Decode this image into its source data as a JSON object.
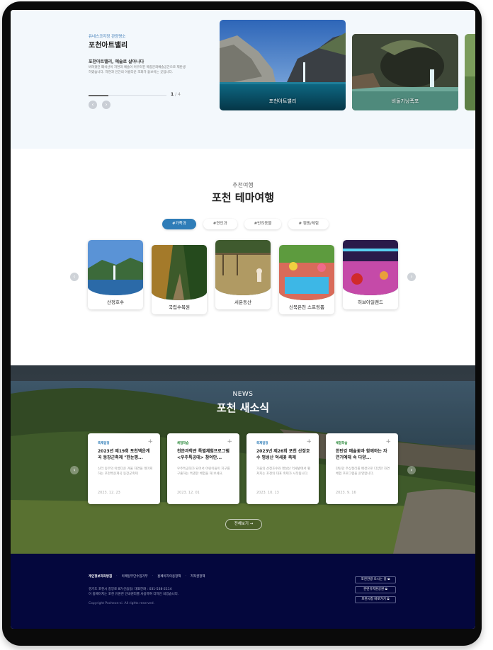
{
  "hero": {
    "category": "유네스코지정 관광명소",
    "title": "포천아트밸리",
    "subtitle": "포천아트밸리, 예술로 살아나다",
    "description": "버려졌던 폐석산이 자연과 예술이 어우러진 복합문화예술공간으로 재탄생하였습니다. 자연과 인간의 아름다운 조화가 돋보이는 곳입니다.",
    "counter_current": "1",
    "counter_separator": "/",
    "counter_total": "4",
    "progress": 0.25,
    "prev_icon": "‹",
    "next_icon": "›",
    "slides": [
      {
        "caption": "포천아트밸리",
        "icon": "photo"
      },
      {
        "caption": "비둘기낭폭포",
        "icon": "photo"
      }
    ]
  },
  "theme": {
    "kicker": "추천여행",
    "title": "포천 테마여행",
    "tabs": [
      {
        "label": "#가족과",
        "active": true
      },
      {
        "label": "#연인과",
        "active": false
      },
      {
        "label": "#반려동물",
        "active": false
      },
      {
        "label": "# 캠핑/체험",
        "active": false
      }
    ],
    "cards": [
      {
        "label": "산정호수"
      },
      {
        "label": "국립수목원"
      },
      {
        "label": "서운동산"
      },
      {
        "label": "신북온천 스프링폼"
      },
      {
        "label": "허브아일랜드"
      }
    ],
    "prev_icon": "‹",
    "next_icon": "›"
  },
  "news": {
    "kicker": "NEWS",
    "title": "포천 새소식",
    "prev_icon": "‹",
    "next_icon": "›",
    "plus_icon": "+",
    "more_label": "전체보기 →",
    "cards": [
      {
        "category": "축제일정",
        "title": "2023년 제19회 포천백운계곡 동장군축제 \"한눈평...",
        "desc": "신라 동부의 아름다운 겨울 자연을 테마로 하는 포천백운계곡 동장군축제",
        "date": "2023. 12. 23"
      },
      {
        "category": "체험학습",
        "title": "천문과학관 특별체험프로그램 <우주특공대> 참여안...",
        "desc": "우주특공대가 되어서 어린이들이 지구를 구출하는 특별한 체험을 해 보세요.",
        "date": "2023. 12. 01"
      },
      {
        "category": "축제일정",
        "title": "2023년 제26회 포천 산정호수 명성산 억새꽃 축제",
        "desc": "가을의 산정호수와 명성산 억새밭에서 펼쳐지는 포천의 대표 축제가 시작됩니다.",
        "date": "2023. 10. 13"
      },
      {
        "category": "체험학습",
        "title": "한탄강 예술꽃과 함께하는 자연거예태 속 다양...",
        "desc": "한탄강 주상절리를 배경으로 다양한 자연체험 프로그램을 운영합니다.",
        "date": "2023. 9. 16"
      }
    ]
  },
  "footer": {
    "links": [
      "개인정보처리방침",
      "이메일무단수집거부",
      "홈페이지이용정책",
      "저작권정책"
    ],
    "info_line1": "경기도 포천시 중앙로 87(신읍동)      대표전화 : 031-538-2114",
    "info_line2": "이 홈페이지는 포천 유원관 안내센터를 사용하여 디자인 되었습니다.",
    "copyright": "Copyright Pocheon-si. All rights reserved.",
    "buttons": [
      "포천관광 오시는 길",
      "관련유지원공원",
      "포천시청 바로가기"
    ],
    "button_icon": "⧉"
  },
  "colors": {
    "accent": "#2f7db8",
    "footer_bg": "#04073d",
    "hero_bg": "#f3f8fc"
  }
}
